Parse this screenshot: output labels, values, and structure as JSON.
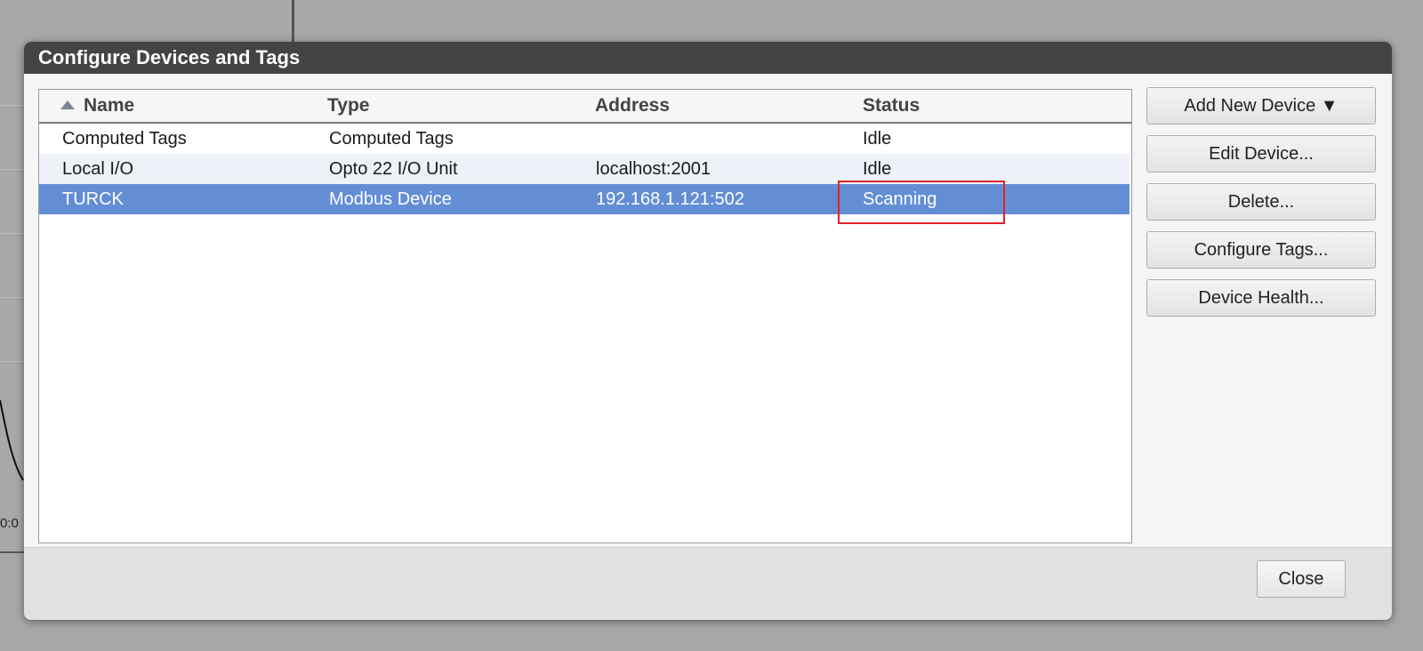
{
  "background": {
    "axis_tick_label": "0:0"
  },
  "dialog": {
    "title": "Configure Devices and Tags",
    "table": {
      "columns": [
        "Name",
        "Type",
        "Address",
        "Status"
      ],
      "sort_column": "Name",
      "sort_direction": "ascending",
      "rows": [
        {
          "name": "Computed Tags",
          "type": "Computed Tags",
          "address": "",
          "status": "Idle"
        },
        {
          "name": "Local I/O",
          "type": "Opto 22 I/O Unit",
          "address": "localhost:2001",
          "status": "Idle"
        },
        {
          "name": "TURCK",
          "type": "Modbus Device",
          "address": "192.168.1.121:502",
          "status": "Scanning"
        }
      ],
      "selected_row": "TURCK",
      "highlighted_cell": "Scanning"
    },
    "buttons": {
      "add_new_device": "Add New Device ▼",
      "edit_device": "Edit Device...",
      "delete": "Delete...",
      "configure_tags": "Configure Tags...",
      "device_health": "Device Health..."
    },
    "close_label": "Close"
  },
  "colors": {
    "titlebar": "#444444",
    "selected_row": "#638ed6",
    "highlight_box": "#e0232b"
  }
}
